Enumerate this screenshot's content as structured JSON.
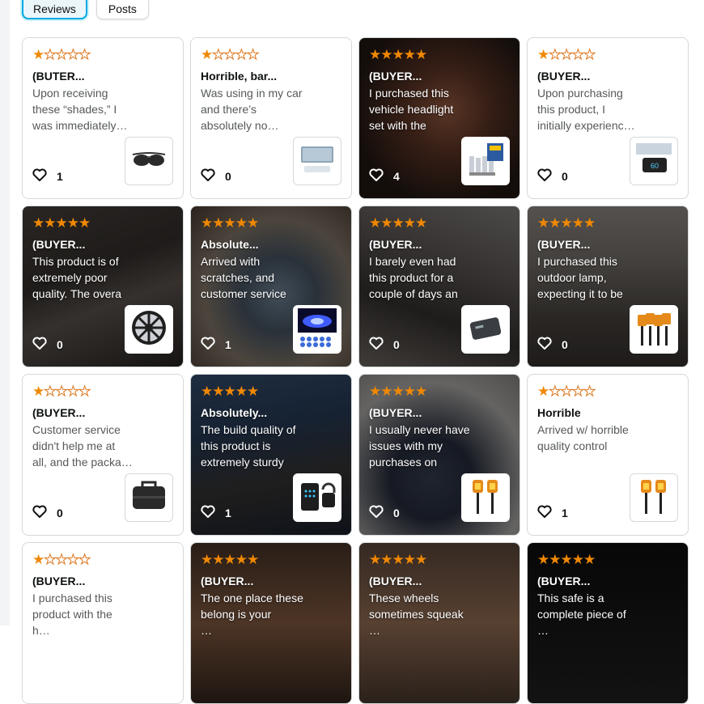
{
  "tabs": [
    {
      "label": "Reviews",
      "active": true
    },
    {
      "label": "Posts",
      "active": false
    }
  ],
  "colors": {
    "star": "#f08804",
    "accent": "#00a8e1"
  },
  "cards": [
    {
      "rating": 1,
      "title": "(BUTER...",
      "lines": [
        "Upon receiving",
        "these “shades,” I",
        "was immediately…"
      ],
      "likes": "1",
      "product_icon": "sunglasses-icon",
      "dark": false
    },
    {
      "rating": 1,
      "title": "Horrible, bar...",
      "lines": [
        "Was using in my car",
        "and there’s",
        "absolutely no…"
      ],
      "likes": "0",
      "product_icon": "sunshade-icon",
      "dark": false
    },
    {
      "rating": 5,
      "title": "(BUYER...",
      "lines": [
        "I purchased this",
        "vehicle headlight",
        "set with the"
      ],
      "likes": "4",
      "product_icon": "headlight-bulbs-icon",
      "dark": true
    },
    {
      "rating": 1,
      "title": "(BUYER...",
      "lines": [
        "Upon purchasing",
        "this product, I",
        "initially experienc…"
      ],
      "likes": "0",
      "product_icon": "head-up-display-icon",
      "dark": false
    },
    {
      "rating": 5,
      "title": "(BUYER...",
      "lines": [
        "This product is of",
        "extremely poor",
        "quality. The overa"
      ],
      "likes": "0",
      "product_icon": "hubcap-icon",
      "dark": true
    },
    {
      "rating": 5,
      "title": "Absolute...",
      "lines": [
        "Arrived with",
        "scratches, and",
        "customer service"
      ],
      "likes": "1",
      "product_icon": "solar-deck-light-icon",
      "dark": true
    },
    {
      "rating": 5,
      "title": "(BUYER...",
      "lines": [
        "I barely even had",
        "this product for a",
        "couple of days an"
      ],
      "likes": "0",
      "product_icon": "power-bank-icon",
      "dark": true
    },
    {
      "rating": 5,
      "title": "(BUYER...",
      "lines": [
        "I purchased this",
        "outdoor lamp,",
        "expecting it to be"
      ],
      "likes": "0",
      "product_icon": "solar-torch-set-icon",
      "dark": true
    },
    {
      "rating": 1,
      "title": "(BUYER...",
      "lines": [
        "Customer service",
        "didn't help me at",
        "all, and the packa…"
      ],
      "likes": "0",
      "product_icon": "laptop-bag-icon",
      "dark": false
    },
    {
      "rating": 5,
      "title": "Absolutely...",
      "lines": [
        "The build quality of",
        "this product is",
        "extremely sturdy"
      ],
      "likes": "1",
      "product_icon": "key-lockbox-icon",
      "dark": true
    },
    {
      "rating": 5,
      "title": "(BUYER...",
      "lines": [
        "I usually never have",
        "issues with my",
        "purchases on"
      ],
      "likes": "0",
      "product_icon": "torch-lights-icon",
      "dark": true
    },
    {
      "rating": 1,
      "title": "Horrible",
      "lines": [
        "Arrived w/ horrible",
        "quality control"
      ],
      "likes": "1",
      "product_icon": "torch-lights-icon",
      "dark": false
    },
    {
      "rating": 1,
      "title": "(BUYER...",
      "lines": [
        "I purchased this",
        "product with the",
        "h…"
      ],
      "likes": "",
      "product_icon": "",
      "dark": false
    },
    {
      "rating": 5,
      "title": "(BUYER...",
      "lines": [
        "The one place these",
        "belong is your",
        "…"
      ],
      "likes": "",
      "product_icon": "",
      "dark": true
    },
    {
      "rating": 5,
      "title": "(BUYER...",
      "lines": [
        "These wheels",
        "sometimes squeak",
        "…"
      ],
      "likes": "",
      "product_icon": "",
      "dark": true
    },
    {
      "rating": 5,
      "title": "(BUYER...",
      "lines": [
        "This safe is a",
        "complete piece of",
        "…"
      ],
      "likes": "",
      "product_icon": "",
      "dark": true
    }
  ]
}
